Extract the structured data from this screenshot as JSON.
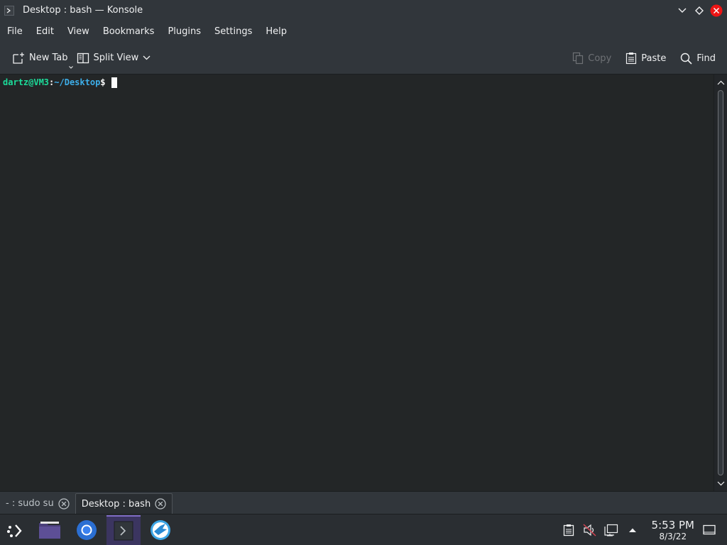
{
  "window": {
    "title": "Desktop : bash — Konsole",
    "icon": "konsole-icon",
    "controls": [
      "minimize-chevron-icon",
      "maximize-diamond-icon",
      "close-icon"
    ],
    "close_color": "#ed1515"
  },
  "menubar": {
    "items": [
      {
        "label": "File"
      },
      {
        "label": "Edit"
      },
      {
        "label": "View"
      },
      {
        "label": "Bookmarks"
      },
      {
        "label": "Plugins"
      },
      {
        "label": "Settings"
      },
      {
        "label": "Help"
      }
    ]
  },
  "toolbar": {
    "new_tab": "New Tab",
    "split_view": "Split View",
    "copy": "Copy",
    "paste": "Paste",
    "find": "Find"
  },
  "terminal": {
    "user_host": "dartz@VM3",
    "colon": ":",
    "path": "~/Desktop",
    "symbol": "$",
    "colors": {
      "user": "#1cdc9a",
      "path": "#3daee9",
      "background": "#232627"
    }
  },
  "session_tabs": [
    {
      "label": "- : sudo su",
      "active": false
    },
    {
      "label": "Desktop : bash",
      "active": true
    }
  ],
  "taskbar": {
    "launcher_icon": "application-launcher-icon",
    "tasks": [
      "file-manager-icon",
      "chromium-icon",
      "konsole-icon",
      "kde-connect-icon"
    ],
    "active_task_color": "#7e6bc4",
    "tray_icons": [
      "clipboard-icon",
      "volume-muted-icon",
      "network-icon",
      "show-hidden-arrow-icon"
    ],
    "clock": {
      "time": "5:53 PM",
      "date": "8/3/22"
    }
  }
}
